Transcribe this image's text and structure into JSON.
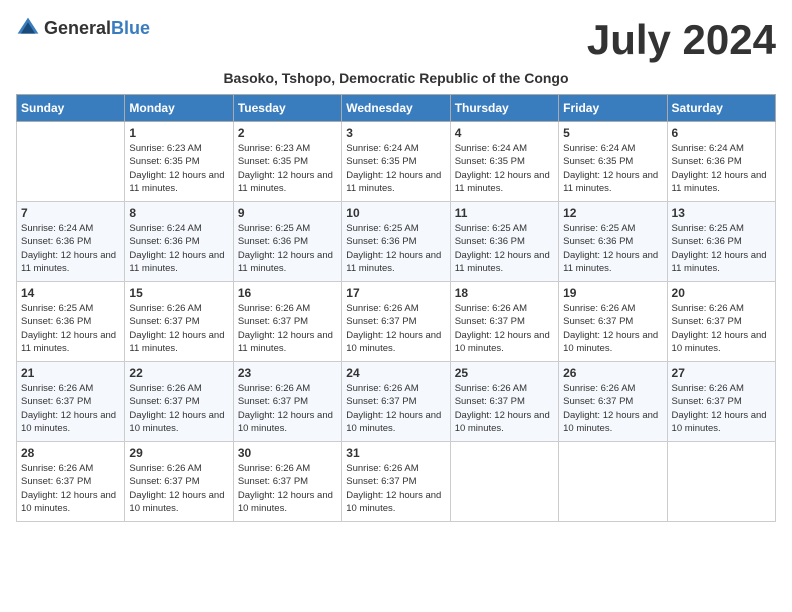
{
  "header": {
    "logo_general": "General",
    "logo_blue": "Blue",
    "month_title": "July 2024",
    "subtitle": "Basoko, Tshopo, Democratic Republic of the Congo"
  },
  "days_of_week": [
    "Sunday",
    "Monday",
    "Tuesday",
    "Wednesday",
    "Thursday",
    "Friday",
    "Saturday"
  ],
  "weeks": [
    [
      {
        "day": "",
        "sunrise": "",
        "sunset": "",
        "daylight": ""
      },
      {
        "day": "1",
        "sunrise": "Sunrise: 6:23 AM",
        "sunset": "Sunset: 6:35 PM",
        "daylight": "Daylight: 12 hours and 11 minutes."
      },
      {
        "day": "2",
        "sunrise": "Sunrise: 6:23 AM",
        "sunset": "Sunset: 6:35 PM",
        "daylight": "Daylight: 12 hours and 11 minutes."
      },
      {
        "day": "3",
        "sunrise": "Sunrise: 6:24 AM",
        "sunset": "Sunset: 6:35 PM",
        "daylight": "Daylight: 12 hours and 11 minutes."
      },
      {
        "day": "4",
        "sunrise": "Sunrise: 6:24 AM",
        "sunset": "Sunset: 6:35 PM",
        "daylight": "Daylight: 12 hours and 11 minutes."
      },
      {
        "day": "5",
        "sunrise": "Sunrise: 6:24 AM",
        "sunset": "Sunset: 6:35 PM",
        "daylight": "Daylight: 12 hours and 11 minutes."
      },
      {
        "day": "6",
        "sunrise": "Sunrise: 6:24 AM",
        "sunset": "Sunset: 6:36 PM",
        "daylight": "Daylight: 12 hours and 11 minutes."
      }
    ],
    [
      {
        "day": "7",
        "sunrise": "Sunrise: 6:24 AM",
        "sunset": "Sunset: 6:36 PM",
        "daylight": "Daylight: 12 hours and 11 minutes."
      },
      {
        "day": "8",
        "sunrise": "Sunrise: 6:24 AM",
        "sunset": "Sunset: 6:36 PM",
        "daylight": "Daylight: 12 hours and 11 minutes."
      },
      {
        "day": "9",
        "sunrise": "Sunrise: 6:25 AM",
        "sunset": "Sunset: 6:36 PM",
        "daylight": "Daylight: 12 hours and 11 minutes."
      },
      {
        "day": "10",
        "sunrise": "Sunrise: 6:25 AM",
        "sunset": "Sunset: 6:36 PM",
        "daylight": "Daylight: 12 hours and 11 minutes."
      },
      {
        "day": "11",
        "sunrise": "Sunrise: 6:25 AM",
        "sunset": "Sunset: 6:36 PM",
        "daylight": "Daylight: 12 hours and 11 minutes."
      },
      {
        "day": "12",
        "sunrise": "Sunrise: 6:25 AM",
        "sunset": "Sunset: 6:36 PM",
        "daylight": "Daylight: 12 hours and 11 minutes."
      },
      {
        "day": "13",
        "sunrise": "Sunrise: 6:25 AM",
        "sunset": "Sunset: 6:36 PM",
        "daylight": "Daylight: 12 hours and 11 minutes."
      }
    ],
    [
      {
        "day": "14",
        "sunrise": "Sunrise: 6:25 AM",
        "sunset": "Sunset: 6:36 PM",
        "daylight": "Daylight: 12 hours and 11 minutes."
      },
      {
        "day": "15",
        "sunrise": "Sunrise: 6:26 AM",
        "sunset": "Sunset: 6:37 PM",
        "daylight": "Daylight: 12 hours and 11 minutes."
      },
      {
        "day": "16",
        "sunrise": "Sunrise: 6:26 AM",
        "sunset": "Sunset: 6:37 PM",
        "daylight": "Daylight: 12 hours and 11 minutes."
      },
      {
        "day": "17",
        "sunrise": "Sunrise: 6:26 AM",
        "sunset": "Sunset: 6:37 PM",
        "daylight": "Daylight: 12 hours and 10 minutes."
      },
      {
        "day": "18",
        "sunrise": "Sunrise: 6:26 AM",
        "sunset": "Sunset: 6:37 PM",
        "daylight": "Daylight: 12 hours and 10 minutes."
      },
      {
        "day": "19",
        "sunrise": "Sunrise: 6:26 AM",
        "sunset": "Sunset: 6:37 PM",
        "daylight": "Daylight: 12 hours and 10 minutes."
      },
      {
        "day": "20",
        "sunrise": "Sunrise: 6:26 AM",
        "sunset": "Sunset: 6:37 PM",
        "daylight": "Daylight: 12 hours and 10 minutes."
      }
    ],
    [
      {
        "day": "21",
        "sunrise": "Sunrise: 6:26 AM",
        "sunset": "Sunset: 6:37 PM",
        "daylight": "Daylight: 12 hours and 10 minutes."
      },
      {
        "day": "22",
        "sunrise": "Sunrise: 6:26 AM",
        "sunset": "Sunset: 6:37 PM",
        "daylight": "Daylight: 12 hours and 10 minutes."
      },
      {
        "day": "23",
        "sunrise": "Sunrise: 6:26 AM",
        "sunset": "Sunset: 6:37 PM",
        "daylight": "Daylight: 12 hours and 10 minutes."
      },
      {
        "day": "24",
        "sunrise": "Sunrise: 6:26 AM",
        "sunset": "Sunset: 6:37 PM",
        "daylight": "Daylight: 12 hours and 10 minutes."
      },
      {
        "day": "25",
        "sunrise": "Sunrise: 6:26 AM",
        "sunset": "Sunset: 6:37 PM",
        "daylight": "Daylight: 12 hours and 10 minutes."
      },
      {
        "day": "26",
        "sunrise": "Sunrise: 6:26 AM",
        "sunset": "Sunset: 6:37 PM",
        "daylight": "Daylight: 12 hours and 10 minutes."
      },
      {
        "day": "27",
        "sunrise": "Sunrise: 6:26 AM",
        "sunset": "Sunset: 6:37 PM",
        "daylight": "Daylight: 12 hours and 10 minutes."
      }
    ],
    [
      {
        "day": "28",
        "sunrise": "Sunrise: 6:26 AM",
        "sunset": "Sunset: 6:37 PM",
        "daylight": "Daylight: 12 hours and 10 minutes."
      },
      {
        "day": "29",
        "sunrise": "Sunrise: 6:26 AM",
        "sunset": "Sunset: 6:37 PM",
        "daylight": "Daylight: 12 hours and 10 minutes."
      },
      {
        "day": "30",
        "sunrise": "Sunrise: 6:26 AM",
        "sunset": "Sunset: 6:37 PM",
        "daylight": "Daylight: 12 hours and 10 minutes."
      },
      {
        "day": "31",
        "sunrise": "Sunrise: 6:26 AM",
        "sunset": "Sunset: 6:37 PM",
        "daylight": "Daylight: 12 hours and 10 minutes."
      },
      {
        "day": "",
        "sunrise": "",
        "sunset": "",
        "daylight": ""
      },
      {
        "day": "",
        "sunrise": "",
        "sunset": "",
        "daylight": ""
      },
      {
        "day": "",
        "sunrise": "",
        "sunset": "",
        "daylight": ""
      }
    ]
  ]
}
